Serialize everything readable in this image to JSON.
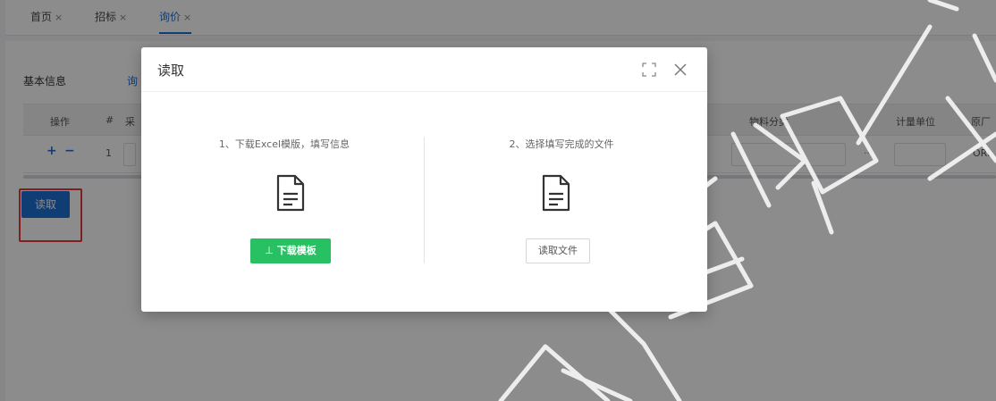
{
  "tabs": [
    {
      "label": "首页",
      "close": "×"
    },
    {
      "label": "招标",
      "close": "×"
    },
    {
      "label": "询价",
      "close": "×"
    }
  ],
  "sub_tabs": {
    "basic_info": "基本信息",
    "second": "询"
  },
  "grid": {
    "headers": {
      "operation": "操作",
      "index": "#",
      "partial": "采",
      "material_category": "物料分类",
      "unit": "计量单位",
      "origin": "原厂"
    },
    "row": {
      "plus": "+",
      "minus": "−",
      "index": "1",
      "ellipsis": "···",
      "origin_value": "ORI"
    }
  },
  "page_read_button": "读取",
  "modal": {
    "title": "读取",
    "step1": "1、下载Excel模版，填写信息",
    "step2": "2、选择填写完成的文件",
    "download_button": "下载模板",
    "download_arrow": "⊥",
    "read_file_button": "读取文件"
  },
  "colors": {
    "primary": "#1f6fd6",
    "success": "#27c163",
    "highlight": "#e8383d"
  }
}
